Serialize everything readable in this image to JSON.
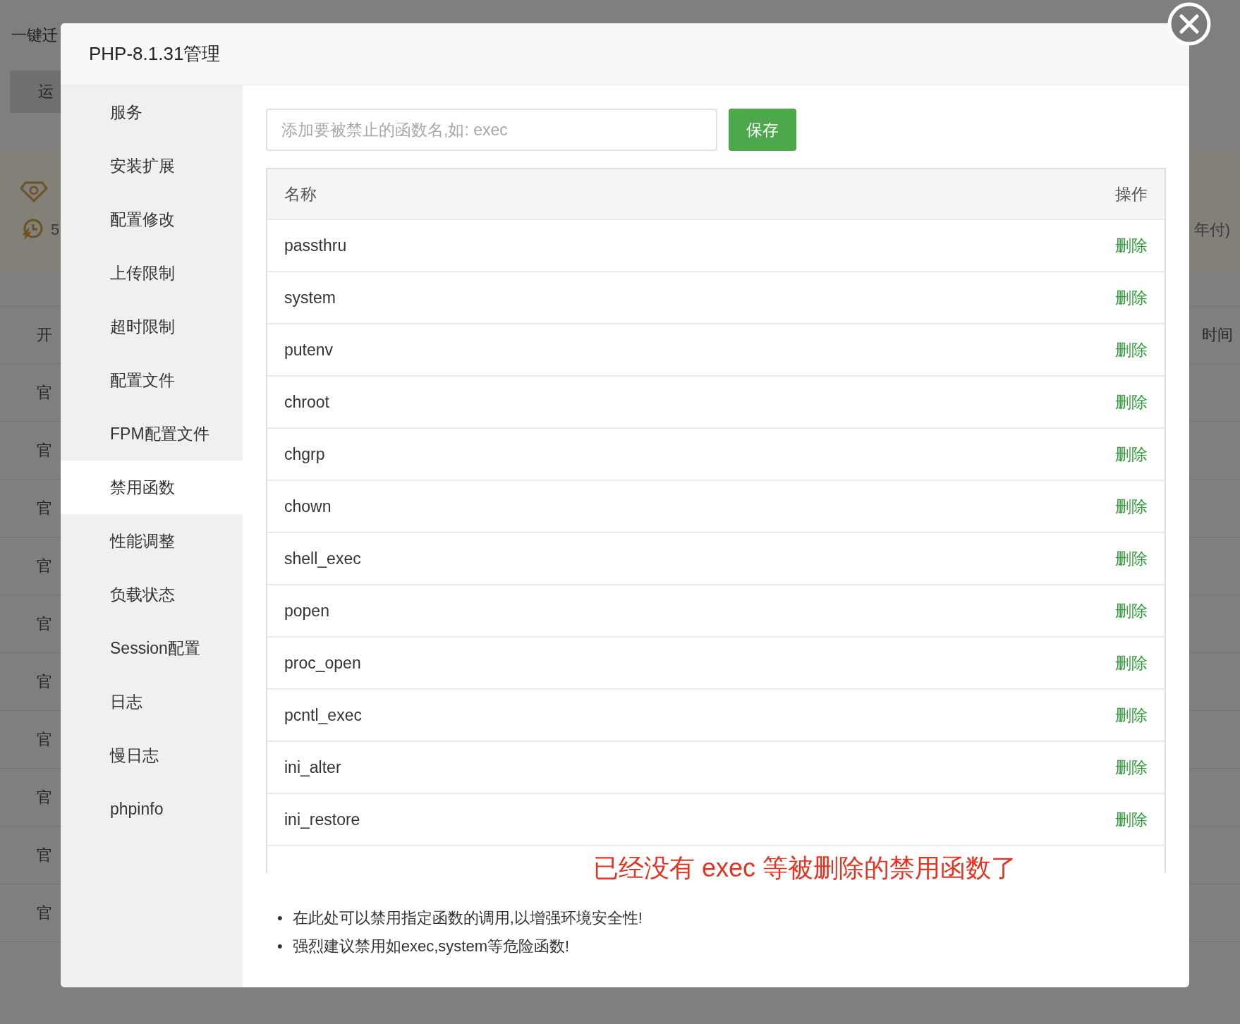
{
  "background": {
    "title": "一键迁",
    "tab": "运",
    "stat": "5",
    "stat_right": "年付)",
    "table_header": {
      "left": "开",
      "right": "时间"
    },
    "rows": [
      "官",
      "官",
      "官",
      "官",
      "官",
      "官",
      "官",
      "官",
      "官",
      "官"
    ]
  },
  "dialog": {
    "title": "PHP-8.1.31管理",
    "menu": [
      {
        "label": "服务",
        "selected": false
      },
      {
        "label": "安装扩展",
        "selected": false
      },
      {
        "label": "配置修改",
        "selected": false
      },
      {
        "label": "上传限制",
        "selected": false
      },
      {
        "label": "超时限制",
        "selected": false
      },
      {
        "label": "配置文件",
        "selected": false
      },
      {
        "label": "FPM配置文件",
        "selected": false
      },
      {
        "label": "禁用函数",
        "selected": true
      },
      {
        "label": "性能调整",
        "selected": false
      },
      {
        "label": "负载状态",
        "selected": false
      },
      {
        "label": "Session配置",
        "selected": false
      },
      {
        "label": "日志",
        "selected": false
      },
      {
        "label": "慢日志",
        "selected": false
      },
      {
        "label": "phpinfo",
        "selected": false
      }
    ],
    "input": {
      "placeholder": "添加要被禁止的函数名,如: exec"
    },
    "save_button": "保存",
    "table": {
      "columns": [
        "名称",
        "操作"
      ],
      "rows": [
        {
          "name": "passthru",
          "action": "删除"
        },
        {
          "name": "system",
          "action": "删除"
        },
        {
          "name": "putenv",
          "action": "删除"
        },
        {
          "name": "chroot",
          "action": "删除"
        },
        {
          "name": "chgrp",
          "action": "删除"
        },
        {
          "name": "chown",
          "action": "删除"
        },
        {
          "name": "shell_exec",
          "action": "删除"
        },
        {
          "name": "popen",
          "action": "删除"
        },
        {
          "name": "proc_open",
          "action": "删除"
        },
        {
          "name": "pcntl_exec",
          "action": "删除"
        },
        {
          "name": "ini_alter",
          "action": "删除"
        },
        {
          "name": "ini_restore",
          "action": "删除"
        }
      ]
    },
    "annotation": "已经没有 exec 等被删除的禁用函数了",
    "note_bullet": "•",
    "notes": [
      "在此处可以禁用指定函数的调用,以增强环境安全性!",
      "强烈建议禁用如exec,system等危险函数!"
    ]
  }
}
